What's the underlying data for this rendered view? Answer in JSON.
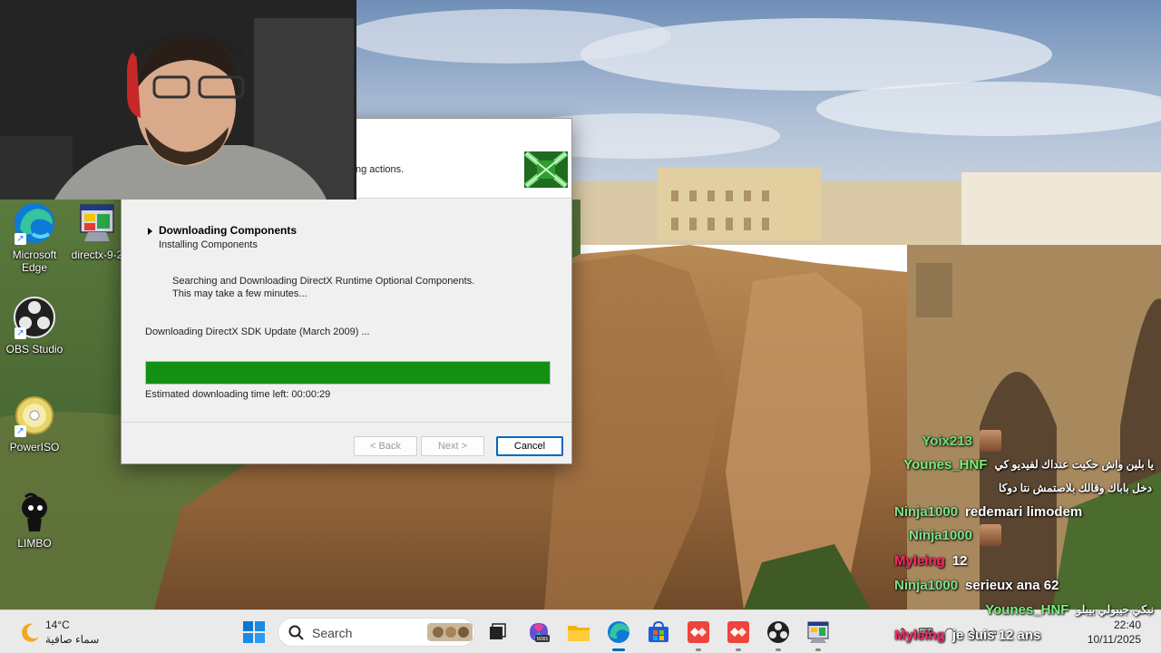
{
  "desktop_icons": [
    {
      "label": "Microsoft Edge",
      "icon": "edge-icon"
    },
    {
      "label": "directx-9-2",
      "icon": "directx-setup-icon"
    },
    {
      "label": "OBS Studio",
      "icon": "obs-icon"
    },
    {
      "label": "PowerISO",
      "icon": "poweriso-icon"
    },
    {
      "label": "LIMBO",
      "icon": "limbo-icon"
    }
  ],
  "installer": {
    "banner_text": "ng actions.",
    "step_title": "Downloading Components",
    "step_subtitle": "Installing Components",
    "desc_line1": "Searching and Downloading DirectX Runtime Optional Components.",
    "desc_line2": "This may take a few minutes...",
    "downloading_item": "Downloading DirectX SDK Update (March 2009) ...",
    "progress": 1.0,
    "eta": "Estimated downloading time left: 00:00:29",
    "buttons": {
      "back": "< Back",
      "next": "Next >",
      "cancel": "Cancel"
    },
    "progress_color": "#139014"
  },
  "chat": [
    {
      "user": "Yoix213",
      "user_color": "#6ee07a",
      "message": "",
      "emote": true
    },
    {
      "user": "Younes_HNF",
      "user_color": "#7cf07a",
      "message": "يا بلين واش حكيت عنداك لفيديو كي",
      "arabic": true
    },
    {
      "user": "",
      "user_color": "#7cf07a",
      "message": "دخل باباك وقالك بلاصتمش نتا دوكا",
      "arabic": true
    },
    {
      "user": "Ninja1000",
      "user_color": "#7de28a",
      "message": "redemari limodem"
    },
    {
      "user": "Ninja1000",
      "user_color": "#7de28a",
      "message": "",
      "emote": true
    },
    {
      "user": "Myleing",
      "user_color": "#ff2a6a",
      "message": "12"
    },
    {
      "user": "Ninja1000",
      "user_color": "#7de28a",
      "message": "serieux ana 62"
    },
    {
      "user": "Younes_HNF",
      "user_color": "#7cf07a",
      "message": "نبكي جيبولي بيبلو",
      "arabic": true
    },
    {
      "user": "Myleing",
      "user_color": "#ff2a6a",
      "message": "je suis 12 ans"
    }
  ],
  "taskbar": {
    "weather_temp": "14°C",
    "weather_cond": "سماء صافية",
    "search_placeholder": "Search",
    "apps": [
      "start-icon",
      "task-view-icon",
      "m365-copilot-icon",
      "file-explorer-icon",
      "edge-icon",
      "microsoft-store-icon",
      "anydesk-icon",
      "anydesk-icon",
      "obs-icon",
      "directx-setup-icon"
    ],
    "time": "22:40",
    "date": "10/11/2025"
  }
}
